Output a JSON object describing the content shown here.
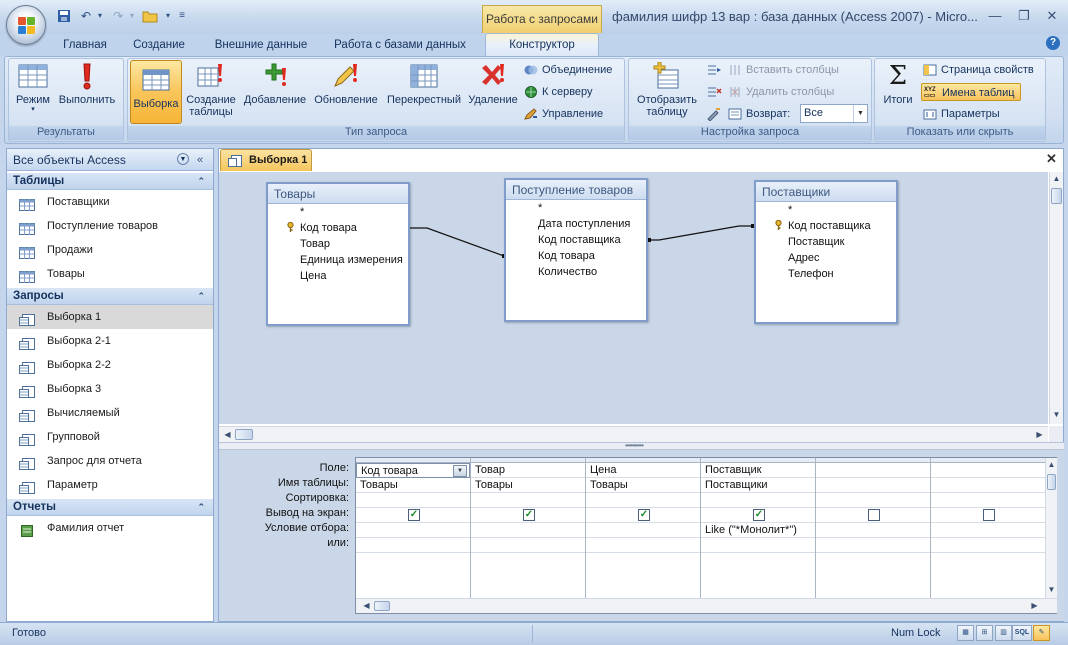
{
  "titlebar": {
    "context_tab_label": "Работа с запросами",
    "window_title": "фамилия шифр 13 вар : база данных (Access 2007) - Micro...",
    "minimize": "—",
    "restore": "❐",
    "close": "✕"
  },
  "tabs": [
    "Главная",
    "Создание",
    "Внешние данные",
    "Работа с базами данных",
    "Конструктор"
  ],
  "ribbon": {
    "results": {
      "label": "Результаты",
      "view": "Режим",
      "run": "Выполнить"
    },
    "query_type": {
      "label": "Тип запроса",
      "select": "Выборка",
      "make_table_1": "Создание",
      "make_table_2": "таблицы",
      "append": "Добавление",
      "update": "Обновление",
      "crosstab": "Перекрестный",
      "delete": "Удаление",
      "union": "Объединение",
      "pass_through": "К серверу",
      "data_definition": "Управление"
    },
    "query_setup": {
      "label": "Настройка запроса",
      "show_table_1": "Отобразить",
      "show_table_2": "таблицу",
      "insert_columns": "Вставить столбцы",
      "delete_columns": "Удалить столбцы",
      "return": "Возврат:",
      "return_value": "Все"
    },
    "show_hide": {
      "label": "Показать или скрыть",
      "totals": "Итоги",
      "property_sheet": "Страница свойств",
      "table_names": "Имена таблиц",
      "parameters": "Параметры"
    }
  },
  "nav": {
    "header": "Все объекты Access",
    "categories": [
      {
        "label": "Таблицы",
        "items": [
          "Поставщики",
          "Поступление товаров",
          "Продажи",
          "Товары"
        ]
      },
      {
        "label": "Запросы",
        "items": [
          "Выборка 1",
          "Выборка 2-1",
          "Выборка 2-2",
          "Выборка 3",
          "Вычисляемый",
          "Групповой",
          "Запрос для отчета",
          "Параметр"
        ]
      },
      {
        "label": "Отчеты",
        "items": [
          "Фамилия отчет"
        ]
      }
    ],
    "selected": "Выборка 1"
  },
  "document": {
    "tab_label": "Выборка 1",
    "tables": [
      {
        "title": "Товары",
        "fields": [
          "*",
          "Код товара",
          "Товар",
          "Единица измерения",
          "Цена"
        ],
        "key_field": "Код товара"
      },
      {
        "title": "Поступление товаров",
        "fields": [
          "*",
          "Дата поступления",
          "Код поставщика",
          "Код товара",
          "Количество"
        ],
        "key_field": ""
      },
      {
        "title": "Поставщики",
        "fields": [
          "*",
          "Код поставщика",
          "Поставщик",
          "Адрес",
          "Телефон"
        ],
        "key_field": "Код поставщика"
      }
    ]
  },
  "qbe": {
    "row_labels": [
      "Поле:",
      "Имя таблицы:",
      "Сортировка:",
      "Вывод на экран:",
      "Условие отбора:",
      "или:"
    ],
    "columns": [
      {
        "field": "Код товара",
        "table": "Товары",
        "sort": "",
        "show": true,
        "criteria": "",
        "or": ""
      },
      {
        "field": "Товар",
        "table": "Товары",
        "sort": "",
        "show": true,
        "criteria": "",
        "or": ""
      },
      {
        "field": "Цена",
        "table": "Товары",
        "sort": "",
        "show": true,
        "criteria": "",
        "or": ""
      },
      {
        "field": "Поставщик",
        "table": "Поставщики",
        "sort": "",
        "show": true,
        "criteria": "Like (\"*Монолит*\")",
        "or": ""
      },
      {
        "field": "",
        "table": "",
        "sort": "",
        "show": false,
        "criteria": "",
        "or": ""
      },
      {
        "field": "",
        "table": "",
        "sort": "",
        "show": false,
        "criteria": "",
        "or": ""
      }
    ]
  },
  "status": {
    "left": "Готово",
    "numlock": "Num Lock",
    "sql": "SQL"
  },
  "colors": {
    "accent_orange": "#f7b537",
    "ribbon_blue": "#d1dff1",
    "design_surface": "#c9d7e8",
    "text_navy": "#15325d"
  }
}
